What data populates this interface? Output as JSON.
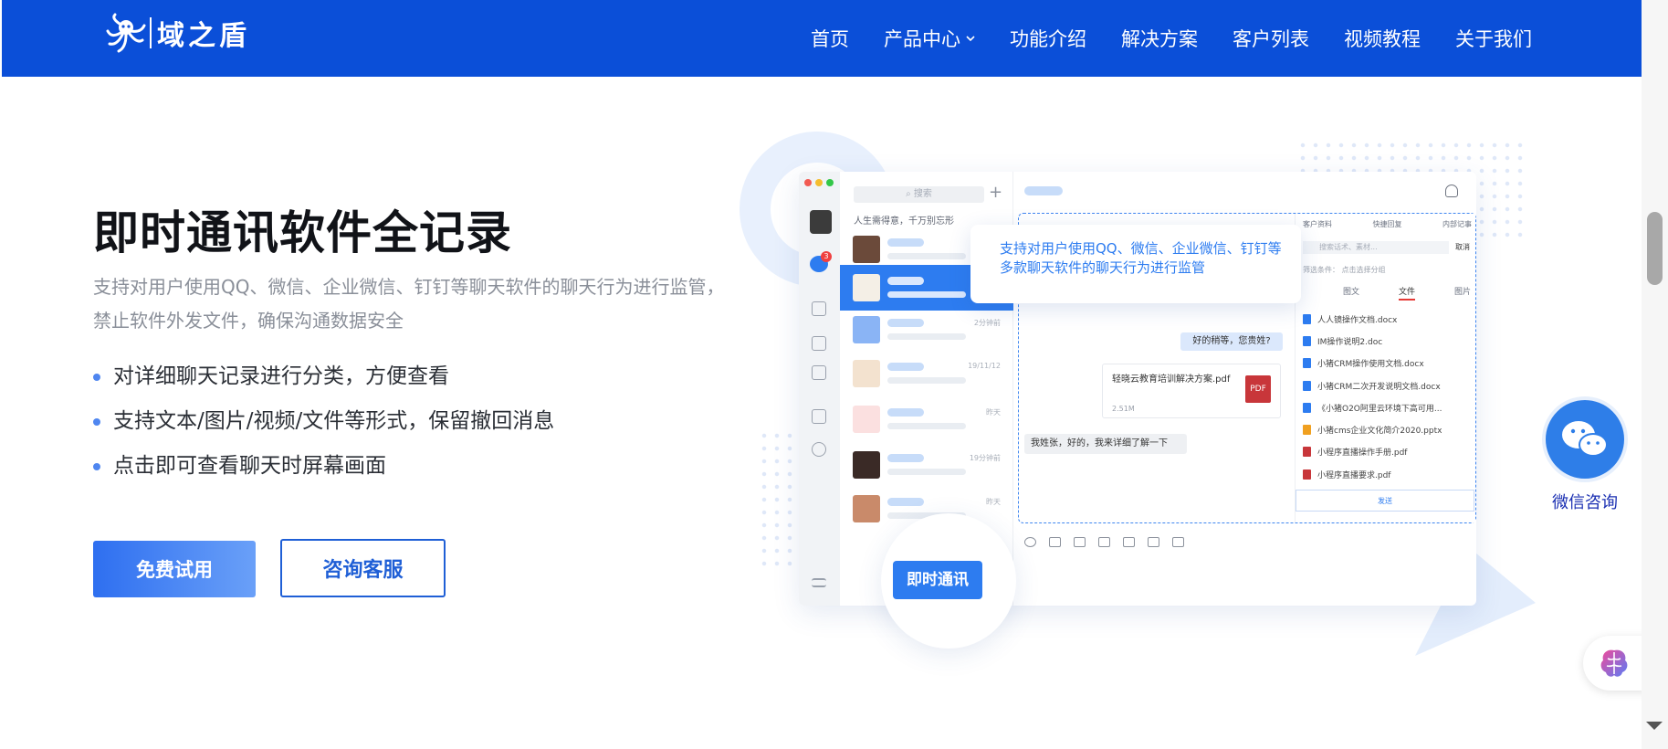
{
  "brand": {
    "logo_text": "域之盾",
    "accent": "#0b4fd8"
  },
  "nav": {
    "items": [
      {
        "label": "首页"
      },
      {
        "label": "产品中心",
        "has_dropdown": true
      },
      {
        "label": "功能介绍"
      },
      {
        "label": "解决方案"
      },
      {
        "label": "客户列表"
      },
      {
        "label": "视频教程"
      },
      {
        "label": "关于我们"
      }
    ]
  },
  "hero": {
    "title": "即时通讯软件全记录",
    "description": "支持对用户使用QQ、微信、企业微信、钉钉等聊天软件的聊天行为进行监管，禁止软件外发文件，确保沟通数据安全",
    "features": [
      "对详细聊天记录进行分类，方便查看",
      "支持文本/图片/视频/文件等形式，保留撤回消息",
      "点击即可查看聊天时屏幕画面"
    ],
    "primary_button": "免费试用",
    "secondary_button": "咨询客服"
  },
  "mockup": {
    "search_placeholder": "搜索",
    "motto": "人生需得意，千万别忘形",
    "conversation_times": [
      "2分钟前",
      "19/11/12",
      "昨天",
      "19分钟前",
      "昨天",
      "昨天"
    ],
    "callout": "支持对用户使用QQ、微信、企业微信、钉钉等多款聊天软件的聊天行为进行监管",
    "bubble_right": "好的稍等，您贵姓?",
    "file_card": {
      "name": "轻晓云教育培训解决方案.pdf",
      "size": "2.51M",
      "type": "PDF"
    },
    "bubble_left": "我姓张，好的，我来详细了解一下",
    "side_tabs": [
      "客户资料",
      "快捷回复",
      "内部记事"
    ],
    "side_search": "搜索话术、素材...",
    "side_cancel": "取消",
    "side_filter": "筛选条件：  点击选择分组",
    "side_subtabs": [
      "图文",
      "文件",
      "图片"
    ],
    "side_active_subtab": "文件",
    "files": [
      {
        "name": "人人镜操作文档.docx",
        "color": "#2d7cf0"
      },
      {
        "name": "IM操作说明2.doc",
        "color": "#2d7cf0"
      },
      {
        "name": "小猪CRM操作使用文档.docx",
        "color": "#2d7cf0"
      },
      {
        "name": "小猪CRM二次开发说明文档.docx",
        "color": "#2d7cf0"
      },
      {
        "name": "《小猪O2O阿里云环境下高可用...",
        "color": "#2d7cf0"
      },
      {
        "name": "小猪cms企业文化简介2020.pptx",
        "color": "#f0a020"
      },
      {
        "name": "小程序直播操作手册.pdf",
        "color": "#c8363a"
      },
      {
        "name": "小程序直播要求.pdf",
        "color": "#c8363a"
      }
    ],
    "send_label": "发送",
    "badge_label": "即时通讯"
  },
  "floating": {
    "wechat_label": "微信咨询"
  }
}
